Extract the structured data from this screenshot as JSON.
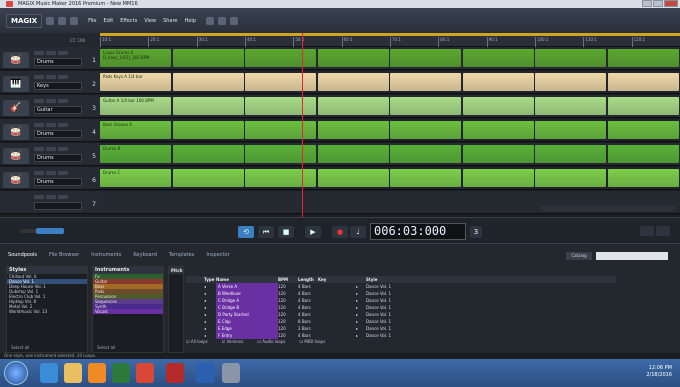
{
  "window": {
    "title": "MAGIX Music Maker 2016 Premium - New MM16"
  },
  "menubar": {
    "logo": "MAGIX",
    "menu": [
      "File",
      "Edit",
      "Effects",
      "View",
      "Share",
      "Help"
    ]
  },
  "ruler": {
    "ticks": [
      "10:1",
      "20:1",
      "30:1",
      "40:1",
      "50:1",
      "60:1",
      "70:1",
      "80:1",
      "90:1",
      "100:1",
      "110:1",
      "120:1"
    ],
    "left_label": "CT: 100"
  },
  "tracks": [
    {
      "name": "Drums",
      "num": "1",
      "icon": "drum-icon",
      "color": "#5aa72e",
      "clip_label": "Loops Drums A D_bass_1(65)_160 BPM"
    },
    {
      "name": "Keys",
      "num": "2",
      "icon": "keys-icon",
      "color": "#f0d9a8",
      "clip_label": "Pads Keys A 1/4 bar"
    },
    {
      "name": "Guitar",
      "num": "3",
      "icon": "guitar-icon",
      "color": "#a9dc87",
      "clip_label": "Guitar A 1/4 bar 160 BPM"
    },
    {
      "name": "Drums",
      "num": "4",
      "icon": "drum-icon",
      "color": "#6bc03e",
      "clip_label": "Bass Groove A"
    },
    {
      "name": "Drums",
      "num": "5",
      "icon": "drum-icon",
      "color": "#58b236",
      "clip_label": "Drums B"
    },
    {
      "name": "Drums",
      "num": "6",
      "icon": "drum-icon",
      "color": "#7dcf4a",
      "clip_label": "Drums C"
    },
    {
      "name": "",
      "num": "7",
      "icon": "",
      "color": "#262b33",
      "clip_label": ""
    }
  ],
  "transport": {
    "time": "006:03:000",
    "tempo": "3"
  },
  "bottom": {
    "tabs": [
      "Soundpools",
      "File Browser",
      "Instruments",
      "Keyboard",
      "Templates",
      "Inspector"
    ],
    "catalog_btn": "Catalog",
    "styles_header": "Styles",
    "styles": [
      "Chillout Vol. 6",
      "Dance Vol. 1",
      "Deep House Vol. 1",
      "Dubstep Vol. 1",
      "Electro Club Vol. 1",
      "HipHop Vol. 8",
      "Metal Vol. 2",
      "Worldmusic Vol. 13"
    ],
    "styles_footer": "Select all",
    "instruments_header": "Instruments",
    "instruments": [
      "Fx",
      "Guitar",
      "Bass",
      "Pads",
      "Percussion",
      "Sequences",
      "Synth",
      "Vocals"
    ],
    "instruments_footer": "Select all",
    "instrument_colors": [
      "#2e5e2e",
      "#8a3a2a",
      "#a26a24",
      "#6d4a2a",
      "#4d5a2a",
      "#5a3a8a",
      "#4a2a8a",
      "#6a2fa2"
    ],
    "pitch_header": "Pitch",
    "table_headers": [
      "Type",
      "Name",
      "BPM",
      "Length",
      "Key",
      "Style"
    ],
    "table_rows": [
      {
        "name": "A Verse A",
        "bpm": "120",
        "length": "4 Bars",
        "style": "Dance Vol. 1"
      },
      {
        "name": "B Weetkuer",
        "bpm": "120",
        "length": "4 Bars",
        "style": "Dance Vol. 1"
      },
      {
        "name": "C Bridge A",
        "bpm": "120",
        "length": "4 Bars",
        "style": "Dance Vol. 1"
      },
      {
        "name": "C Bridge B",
        "bpm": "120",
        "length": "4 Bars",
        "style": "Dance Vol. 1"
      },
      {
        "name": "D Party Started",
        "bpm": "120",
        "length": "4 Bars",
        "style": "Dance Vol. 1"
      },
      {
        "name": "E Clap",
        "bpm": "120",
        "length": "8 Bars",
        "style": "Dance Vol. 1"
      },
      {
        "name": "E Edge",
        "bpm": "120",
        "length": "2 Bars",
        "style": "Dance Vol. 1"
      },
      {
        "name": "F Entry",
        "bpm": "120",
        "length": "4 Bars",
        "style": "Dance Vol. 1"
      }
    ],
    "footer_checks": [
      "All loops",
      "Versions",
      "Audio loops",
      "MIDI loops"
    ],
    "status": "One style, one instrument selected. 20 Loops."
  },
  "taskbar": {
    "time": "12:06 PM",
    "date": "2/18/2016"
  }
}
